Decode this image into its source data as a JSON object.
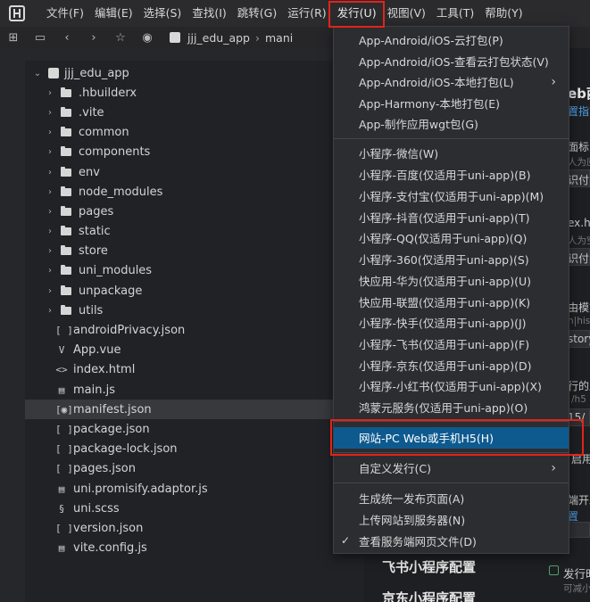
{
  "menubar": {
    "items": [
      "文件(F)",
      "编辑(E)",
      "选择(S)",
      "查找(I)",
      "跳转(G)",
      "运行(R)",
      "发行(U)",
      "视图(V)",
      "工具(T)",
      "帮助(Y)"
    ]
  },
  "toolbar": {
    "crumbs": [
      "jjj_edu_app",
      "mani"
    ]
  },
  "sidebar": {
    "root": "jjj_edu_app",
    "items": [
      {
        "label": ".hbuilderx",
        "icon": "folder-icon"
      },
      {
        "label": ".vite",
        "icon": "folder-icon"
      },
      {
        "label": "common",
        "icon": "folder-icon"
      },
      {
        "label": "components",
        "icon": "folder-icon"
      },
      {
        "label": "env",
        "icon": "folder-icon"
      },
      {
        "label": "node_modules",
        "icon": "folder-icon"
      },
      {
        "label": "pages",
        "icon": "folder-icon"
      },
      {
        "label": "static",
        "icon": "folder-icon"
      },
      {
        "label": "store",
        "icon": "folder-icon"
      },
      {
        "label": "uni_modules",
        "icon": "folder-icon"
      },
      {
        "label": "unpackage",
        "icon": "folder-icon"
      },
      {
        "label": "utils",
        "icon": "folder-icon"
      },
      {
        "label": "androidPrivacy.json",
        "icon": "json-icon"
      },
      {
        "label": "App.vue",
        "icon": "vue-icon"
      },
      {
        "label": "index.html",
        "icon": "html-icon"
      },
      {
        "label": "main.js",
        "icon": "js-icon"
      },
      {
        "label": "manifest.json",
        "icon": "manifest-icon"
      },
      {
        "label": "package.json",
        "icon": "json-icon"
      },
      {
        "label": "package-lock.json",
        "icon": "json-icon"
      },
      {
        "label": "pages.json",
        "icon": "json-icon"
      },
      {
        "label": "uni.promisify.adaptor.js",
        "icon": "js-icon"
      },
      {
        "label": "uni.scss",
        "icon": "scss-icon"
      },
      {
        "label": "version.json",
        "icon": "json-icon"
      },
      {
        "label": "vite.config.js",
        "icon": "js-icon"
      }
    ]
  },
  "dropdown": {
    "items": [
      "App-Android/iOS-云打包(P)",
      "App-Android/iOS-查看云打包状态(V)",
      "App-Android/iOS-本地打包(L)",
      "App-Harmony-本地打包(E)",
      "App-制作应用wgt包(G)",
      "小程序-微信(W)",
      "小程序-百度(仅适用于uni-app)(B)",
      "小程序-支付宝(仅适用于uni-app)(M)",
      "小程序-抖音(仅适用于uni-app)(T)",
      "小程序-QQ(仅适用于uni-app)(Q)",
      "小程序-360(仅适用于uni-app)(S)",
      "快应用-华为(仅适用于uni-app)(U)",
      "快应用-联盟(仅适用于uni-app)(K)",
      "小程序-快手(仅适用于uni-app)(J)",
      "小程序-飞书(仅适用于uni-app)(F)",
      "小程序-京东(仅适用于uni-app)(D)",
      "小程序-小红书(仅适用于uni-app)(X)",
      "鸿蒙元服务(仅适用于uni-app)(O)",
      "网站-PC Web或手机H5(H)",
      "自定义发行(C)",
      "生成统一发布页面(A)",
      "上传网站到服务器(N)",
      "查看服务端网页文件(D)"
    ]
  },
  "right_pane": {
    "heading_fragment": "eb酉",
    "link_fragment": "置指南",
    "t1": "面标",
    "t2": "人为应",
    "t3": "识付",
    "t4": "ex.h",
    "t5": "人为空",
    "t6": "识付",
    "t7": "由模式",
    "t8": "h|his",
    "t9": "story",
    "t10": "行的路",
    "t11": "/h5",
    "t12": "15/",
    "t13": "启用",
    "t14": "端开发",
    "t15": "置",
    "feishu_title": "飞书小程序配置",
    "jd_title": "京东小程序配置",
    "publish_fragment": "发行时",
    "reduce_fragment": "可减小"
  }
}
